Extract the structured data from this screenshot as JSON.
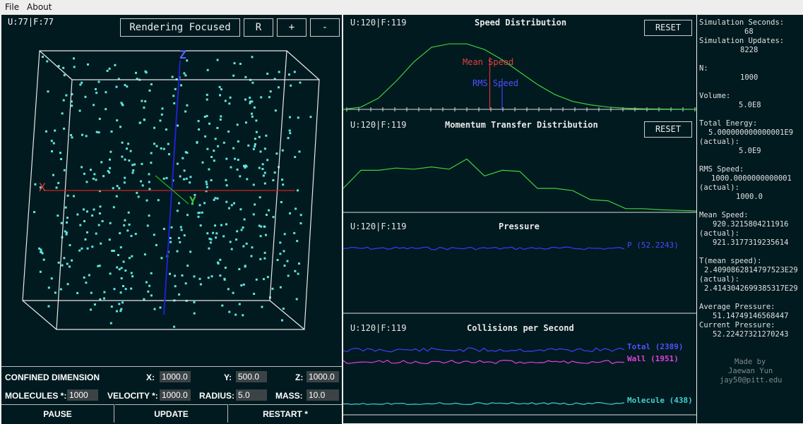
{
  "menu": {
    "file": "File",
    "about": "About"
  },
  "sim": {
    "fps": "U:77|F:77",
    "rendering_button": "Rendering Focused",
    "r_button": "R",
    "plus_button": "+",
    "minus_button": "-",
    "axis_x": "X",
    "axis_y": "Y",
    "axis_z": "Z",
    "particle_color": "#5ee6e0"
  },
  "controls": {
    "confined_label": "CONFINED DIMENSION",
    "x_label": "X:",
    "x_value": "1000.0",
    "y_label": "Y:",
    "y_value": "500.0",
    "z_label": "Z:",
    "z_value": "1000.0",
    "molecules_label": "MOLECULES *:",
    "molecules_value": "1000",
    "velocity_label": "VELOCITY *:",
    "velocity_value": "1000.0",
    "radius_label": "RADIUS:",
    "radius_value": "5.0",
    "mass_label": "MASS:",
    "mass_value": "10.0",
    "pause": "PAUSE",
    "update": "UPDATE",
    "restart": "RESTART *"
  },
  "graphs": {
    "speed": {
      "fps": "U:120|F:119",
      "title": "Speed Distribution",
      "reset": "RESET",
      "mean_label": "Mean Speed",
      "rms_label": "RMS Speed",
      "curve": [
        0,
        2,
        10,
        25,
        42,
        55,
        58,
        58,
        53,
        44,
        33,
        22,
        13,
        7,
        4,
        2,
        1,
        0.5,
        0.3,
        0.2,
        0.1
      ],
      "mean_at": 8.3,
      "rms_at": 9.0
    },
    "momentum": {
      "fps": "U:120|F:119",
      "title": "Momentum Transfer Distribution",
      "reset": "RESET",
      "curve": [
        20,
        36,
        36,
        38,
        37,
        39,
        37,
        46,
        31,
        36,
        35,
        20,
        20,
        18,
        10,
        9,
        2,
        2,
        1,
        0.5,
        0
      ]
    },
    "pressure": {
      "fps": "U:120|F:119",
      "title": "Pressure",
      "label": "P (52.2243)",
      "color": "#3a3aff"
    },
    "collisions": {
      "fps": "U:120|F:119",
      "title": "Collisions per Second",
      "total_label": "Total (2389)",
      "wall_label": "Wall (1951)",
      "molecule_label": "Molecule (438)",
      "total_color": "#4040ff",
      "wall_color": "#e040e0",
      "molecule_color": "#40d0d0"
    }
  },
  "side": {
    "sim_seconds_label": "Simulation Seconds:",
    "sim_seconds": "68",
    "sim_updates_label": "Simulation Updates:",
    "sim_updates": "8228",
    "n_label": "N:",
    "n": "1000",
    "volume_label": "Volume:",
    "volume": "5.0E8",
    "total_energy_label": "Total Energy:",
    "total_energy": "5.000000000000001E9",
    "actual1_label": "(actual):",
    "total_energy_actual": "5.0E9",
    "rms_label": "RMS Speed:",
    "rms": "1000.0000000000001",
    "actual2_label": "(actual):",
    "rms_actual": "1000.0",
    "mean_label": "Mean Speed:",
    "mean": "920.3215804211916",
    "actual3_label": "(actual):",
    "mean_actual": "921.3177319235614",
    "t_label": "T(mean speed):",
    "t": "2.4090862814797523E29",
    "actual4_label": "(actual):",
    "t_actual": "2.4143042699385317E29",
    "avg_pressure_label": "Average Pressure:",
    "avg_pressure": "51.14749146568447",
    "cur_pressure_label": "Current Pressure:",
    "cur_pressure": "52.22427321270243",
    "made_by": "Made by",
    "author": "Jaewan Yun",
    "email": "jay50@pitt.edu"
  }
}
